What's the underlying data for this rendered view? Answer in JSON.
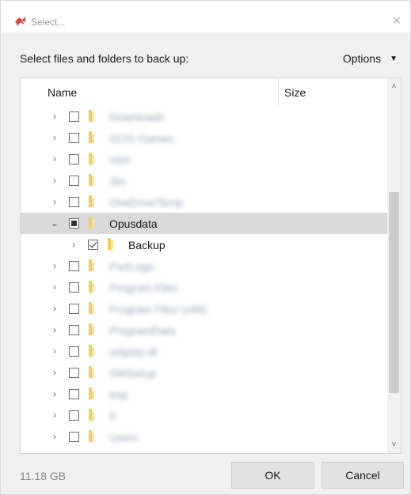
{
  "window": {
    "title": "Select...",
    "close_glyph": "✕"
  },
  "prompt": "Select files and folders to back up:",
  "options": {
    "label": "Options",
    "caret": "▼"
  },
  "tree": {
    "columns": {
      "name": "Name",
      "size": "Size"
    },
    "rows": [
      {
        "level": 0,
        "chevron": "›",
        "check": "none",
        "name": "Downloads",
        "hidden": true
      },
      {
        "level": 0,
        "chevron": "›",
        "check": "none",
        "name": "GOG Games",
        "hidden": true
      },
      {
        "level": 0,
        "chevron": "›",
        "check": "none",
        "name": "Intel",
        "hidden": true
      },
      {
        "level": 0,
        "chevron": "›",
        "check": "none",
        "name": "Jks",
        "hidden": true
      },
      {
        "level": 0,
        "chevron": "›",
        "check": "none",
        "name": "OneDriveTemp",
        "hidden": true
      },
      {
        "level": 0,
        "chevron": "⌄",
        "check": "partial",
        "name": "Opusdata",
        "hidden": false,
        "selected": true
      },
      {
        "level": 1,
        "chevron": "›",
        "check": "checked",
        "name": "Backup",
        "hidden": false
      },
      {
        "level": 0,
        "chevron": "›",
        "check": "none",
        "name": "PerfLogs",
        "hidden": true
      },
      {
        "level": 0,
        "chevron": "›",
        "check": "none",
        "name": "Program Files",
        "hidden": true
      },
      {
        "level": 0,
        "chevron": "›",
        "check": "none",
        "name": "Program Files (x86)",
        "hidden": true
      },
      {
        "level": 0,
        "chevron": "›",
        "check": "none",
        "name": "ProgramData",
        "hidden": true
      },
      {
        "level": 0,
        "chevron": "›",
        "check": "none",
        "name": "setplay-dl",
        "hidden": true
      },
      {
        "level": 0,
        "chevron": "›",
        "check": "none",
        "name": "SWSetup",
        "hidden": true
      },
      {
        "level": 0,
        "chevron": "›",
        "check": "none",
        "name": "tmp",
        "hidden": true
      },
      {
        "level": 0,
        "chevron": "›",
        "check": "none",
        "name": "tt",
        "hidden": true
      },
      {
        "level": 0,
        "chevron": "›",
        "check": "none",
        "name": "Users",
        "hidden": true
      }
    ],
    "scroll_up": "˄",
    "scroll_down": "˅"
  },
  "footer": {
    "total_size": "11.18 GB",
    "ok_label": "OK",
    "cancel_label": "Cancel"
  },
  "colors": {
    "folder": "#f2cf5b",
    "selected_row": "#d9d9d9",
    "app_icon": "#e0403a"
  }
}
